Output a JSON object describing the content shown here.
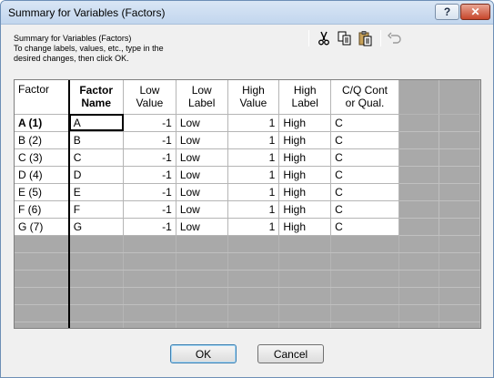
{
  "window": {
    "title": "Summary for Variables (Factors)",
    "help_label": "?",
    "close_label": "✕"
  },
  "description": {
    "lines": [
      "Summary for Variables (Factors)",
      "To change labels, values, etc., type in the",
      "desired changes, then click OK."
    ]
  },
  "toolbar": {
    "icons": [
      "cut-icon",
      "copy-icon",
      "paste-icon",
      "undo-icon"
    ]
  },
  "table": {
    "headers": {
      "factor": "Factor",
      "factor_name": [
        "Factor",
        "Name"
      ],
      "low_value": [
        "Low",
        "Value"
      ],
      "low_label": [
        "Low",
        "Label"
      ],
      "high_value": [
        "High",
        "Value"
      ],
      "high_label": [
        "High",
        "Label"
      ],
      "cq": [
        "C/Q Cont",
        "or Qual."
      ]
    },
    "rows": [
      {
        "factor": "A  (1)",
        "name": "A",
        "low_value": "-1",
        "low_label": "Low",
        "high_value": "1",
        "high_label": "High",
        "cq": "C"
      },
      {
        "factor": "B  (2)",
        "name": "B",
        "low_value": "-1",
        "low_label": "Low",
        "high_value": "1",
        "high_label": "High",
        "cq": "C"
      },
      {
        "factor": "C  (3)",
        "name": "C",
        "low_value": "-1",
        "low_label": "Low",
        "high_value": "1",
        "high_label": "High",
        "cq": "C"
      },
      {
        "factor": "D  (4)",
        "name": "D",
        "low_value": "-1",
        "low_label": "Low",
        "high_value": "1",
        "high_label": "High",
        "cq": "C"
      },
      {
        "factor": "E  (5)",
        "name": "E",
        "low_value": "-1",
        "low_label": "Low",
        "high_value": "1",
        "high_label": "High",
        "cq": "C"
      },
      {
        "factor": "F  (6)",
        "name": "F",
        "low_value": "-1",
        "low_label": "Low",
        "high_value": "1",
        "high_label": "High",
        "cq": "C"
      },
      {
        "factor": "G  (7)",
        "name": "G",
        "low_value": "-1",
        "low_label": "Low",
        "high_value": "1",
        "high_label": "High",
        "cq": "C"
      }
    ]
  },
  "buttons": {
    "ok": "OK",
    "cancel": "Cancel"
  }
}
